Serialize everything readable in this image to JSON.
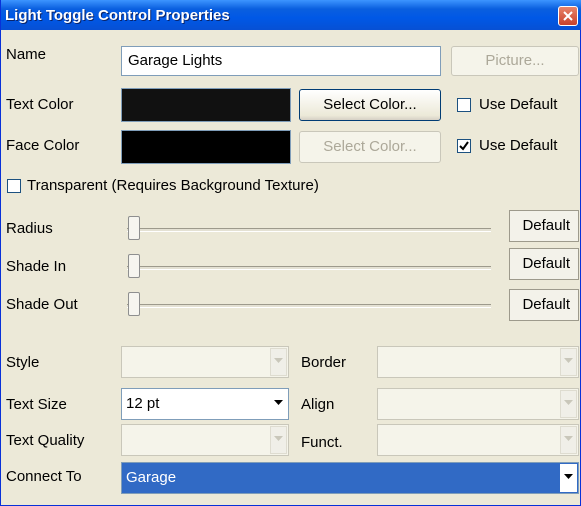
{
  "window": {
    "title": "Light Toggle Control Properties"
  },
  "name": {
    "label": "Name",
    "value": "Garage Lights",
    "picture_button": "Picture..."
  },
  "text_color": {
    "label": "Text Color",
    "swatch_color": "#111111",
    "select_button": "Select Color...",
    "use_default_label": "Use Default",
    "use_default_checked": false
  },
  "face_color": {
    "label": "Face Color",
    "swatch_color": "#000000",
    "select_button": "Select Color...",
    "use_default_label": "Use Default",
    "use_default_checked": true
  },
  "transparent": {
    "label": "Transparent (Requires Background Texture)",
    "checked": false
  },
  "sliders": [
    {
      "label": "Radius",
      "button": "Default",
      "level": 0
    },
    {
      "label": "Shade In",
      "button": "Default",
      "level": 0
    },
    {
      "label": "Shade Out",
      "button": "Default",
      "level": 0
    }
  ],
  "style": {
    "label": "Style",
    "value": ""
  },
  "border": {
    "label": "Border",
    "value": ""
  },
  "text_size": {
    "label": "Text Size",
    "value": "12 pt"
  },
  "align": {
    "label": "Align",
    "value": ""
  },
  "text_quality": {
    "label": "Text Quality",
    "value": ""
  },
  "funct": {
    "label": "Funct.",
    "value": ""
  },
  "connect_to": {
    "label": "Connect To",
    "value": "Garage"
  }
}
